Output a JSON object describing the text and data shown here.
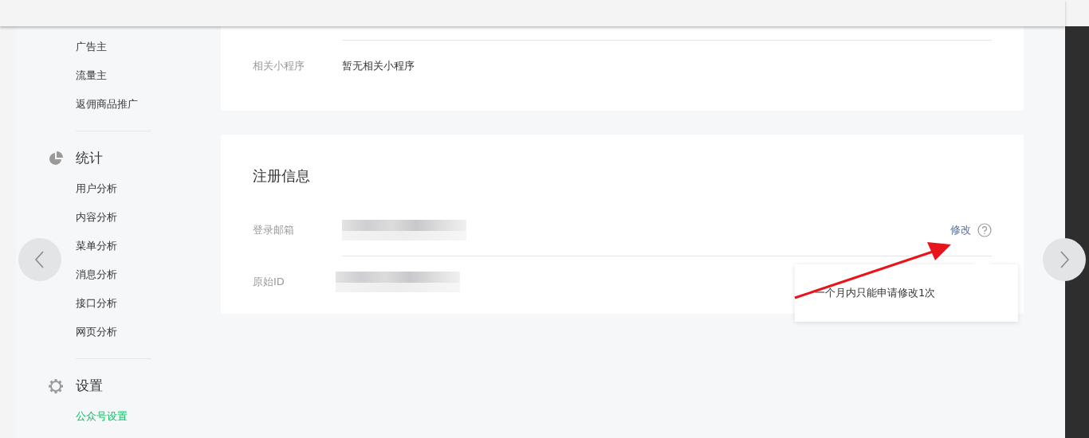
{
  "sidebar": {
    "sections": [
      {
        "items": [
          {
            "label": "广告主",
            "selected": false
          },
          {
            "label": "流量主",
            "selected": false
          },
          {
            "label": "返佣商品推广",
            "selected": false
          }
        ]
      },
      {
        "heading": "统计",
        "items": [
          {
            "label": "用户分析",
            "selected": false
          },
          {
            "label": "内容分析",
            "selected": false
          },
          {
            "label": "菜单分析",
            "selected": false
          },
          {
            "label": "消息分析",
            "selected": false
          },
          {
            "label": "接口分析",
            "selected": false
          },
          {
            "label": "网页分析",
            "selected": false
          }
        ]
      },
      {
        "heading": "设置",
        "items": [
          {
            "label": "公众号设置",
            "selected": true
          }
        ]
      }
    ]
  },
  "cards": [
    {
      "rows": [
        {
          "label": "相关小程序",
          "kind": "text",
          "value": "暂无相关小程序"
        }
      ]
    },
    {
      "title": "注册信息",
      "rows": [
        {
          "label": "登录邮箱",
          "kind": "redacted",
          "action": "修改"
        },
        {
          "label": "原始ID",
          "kind": "redacted"
        }
      ]
    }
  ],
  "tooltip": {
    "text": "一个月内只能申请修改1次"
  }
}
